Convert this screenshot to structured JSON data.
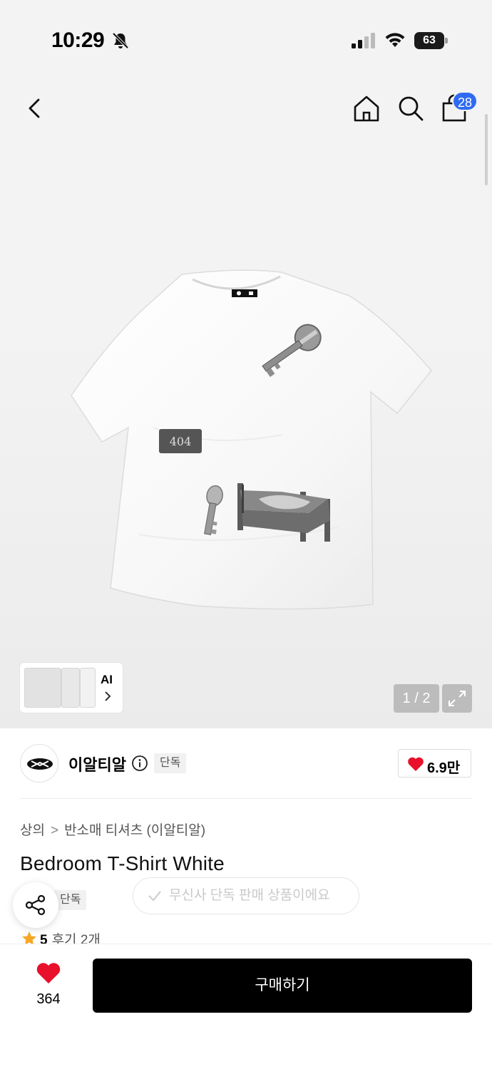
{
  "status_bar": {
    "time": "10:29",
    "battery": "63"
  },
  "nav": {
    "cart_count": "28"
  },
  "gallery": {
    "thumb_ai_label": "AI",
    "page_indicator": "1 / 2",
    "shirt_print_number": "404"
  },
  "brand": {
    "name": "이알티알",
    "exclusive_tag": "단독",
    "likes": "6.9만"
  },
  "breadcrumb": {
    "category": "상의",
    "separator": ">",
    "subcategory": "반소매 티셔츠 (이알티알)"
  },
  "product": {
    "title": "Bedroom T-Shirt White",
    "tag": "단독"
  },
  "toast": {
    "text": "무신사 단독 판매 상품이에요"
  },
  "rating": {
    "score": "5",
    "reviews": "후기 2개"
  },
  "bottom": {
    "like_count": "364",
    "buy_label": "구매하기"
  },
  "colors": {
    "accent_blue": "#2f6bf2",
    "heart_red": "#e8102a",
    "star_orange": "#f5a623",
    "buy_button": "#000000"
  }
}
